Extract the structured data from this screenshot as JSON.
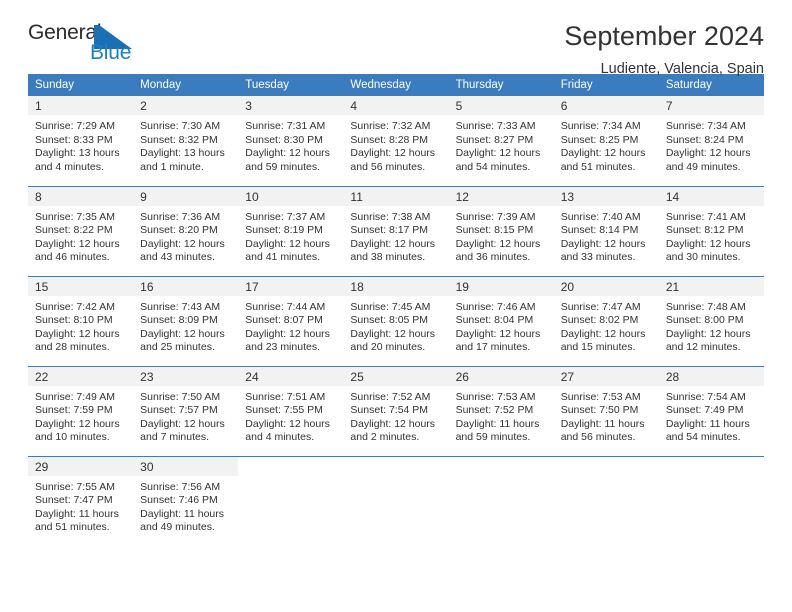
{
  "brand": {
    "name_top": "General",
    "name_bottom": "Blue",
    "accent_color": "#1b6fb5",
    "text_color": "#2b2b2b"
  },
  "header": {
    "month_title": "September 2024",
    "location": "Ludiente, Valencia, Spain"
  },
  "calendar": {
    "header_bg": "#3a7cbe",
    "daynum_bg": "#f2f2f2",
    "weekday_headers": [
      "Sunday",
      "Monday",
      "Tuesday",
      "Wednesday",
      "Thursday",
      "Friday",
      "Saturday"
    ],
    "weeks": [
      [
        {
          "day": "1",
          "sunrise": "Sunrise: 7:29 AM",
          "sunset": "Sunset: 8:33 PM",
          "daylight_line1": "Daylight: 13 hours",
          "daylight_line2": "and 4 minutes."
        },
        {
          "day": "2",
          "sunrise": "Sunrise: 7:30 AM",
          "sunset": "Sunset: 8:32 PM",
          "daylight_line1": "Daylight: 13 hours",
          "daylight_line2": "and 1 minute."
        },
        {
          "day": "3",
          "sunrise": "Sunrise: 7:31 AM",
          "sunset": "Sunset: 8:30 PM",
          "daylight_line1": "Daylight: 12 hours",
          "daylight_line2": "and 59 minutes."
        },
        {
          "day": "4",
          "sunrise": "Sunrise: 7:32 AM",
          "sunset": "Sunset: 8:28 PM",
          "daylight_line1": "Daylight: 12 hours",
          "daylight_line2": "and 56 minutes."
        },
        {
          "day": "5",
          "sunrise": "Sunrise: 7:33 AM",
          "sunset": "Sunset: 8:27 PM",
          "daylight_line1": "Daylight: 12 hours",
          "daylight_line2": "and 54 minutes."
        },
        {
          "day": "6",
          "sunrise": "Sunrise: 7:34 AM",
          "sunset": "Sunset: 8:25 PM",
          "daylight_line1": "Daylight: 12 hours",
          "daylight_line2": "and 51 minutes."
        },
        {
          "day": "7",
          "sunrise": "Sunrise: 7:34 AM",
          "sunset": "Sunset: 8:24 PM",
          "daylight_line1": "Daylight: 12 hours",
          "daylight_line2": "and 49 minutes."
        }
      ],
      [
        {
          "day": "8",
          "sunrise": "Sunrise: 7:35 AM",
          "sunset": "Sunset: 8:22 PM",
          "daylight_line1": "Daylight: 12 hours",
          "daylight_line2": "and 46 minutes."
        },
        {
          "day": "9",
          "sunrise": "Sunrise: 7:36 AM",
          "sunset": "Sunset: 8:20 PM",
          "daylight_line1": "Daylight: 12 hours",
          "daylight_line2": "and 43 minutes."
        },
        {
          "day": "10",
          "sunrise": "Sunrise: 7:37 AM",
          "sunset": "Sunset: 8:19 PM",
          "daylight_line1": "Daylight: 12 hours",
          "daylight_line2": "and 41 minutes."
        },
        {
          "day": "11",
          "sunrise": "Sunrise: 7:38 AM",
          "sunset": "Sunset: 8:17 PM",
          "daylight_line1": "Daylight: 12 hours",
          "daylight_line2": "and 38 minutes."
        },
        {
          "day": "12",
          "sunrise": "Sunrise: 7:39 AM",
          "sunset": "Sunset: 8:15 PM",
          "daylight_line1": "Daylight: 12 hours",
          "daylight_line2": "and 36 minutes."
        },
        {
          "day": "13",
          "sunrise": "Sunrise: 7:40 AM",
          "sunset": "Sunset: 8:14 PM",
          "daylight_line1": "Daylight: 12 hours",
          "daylight_line2": "and 33 minutes."
        },
        {
          "day": "14",
          "sunrise": "Sunrise: 7:41 AM",
          "sunset": "Sunset: 8:12 PM",
          "daylight_line1": "Daylight: 12 hours",
          "daylight_line2": "and 30 minutes."
        }
      ],
      [
        {
          "day": "15",
          "sunrise": "Sunrise: 7:42 AM",
          "sunset": "Sunset: 8:10 PM",
          "daylight_line1": "Daylight: 12 hours",
          "daylight_line2": "and 28 minutes."
        },
        {
          "day": "16",
          "sunrise": "Sunrise: 7:43 AM",
          "sunset": "Sunset: 8:09 PM",
          "daylight_line1": "Daylight: 12 hours",
          "daylight_line2": "and 25 minutes."
        },
        {
          "day": "17",
          "sunrise": "Sunrise: 7:44 AM",
          "sunset": "Sunset: 8:07 PM",
          "daylight_line1": "Daylight: 12 hours",
          "daylight_line2": "and 23 minutes."
        },
        {
          "day": "18",
          "sunrise": "Sunrise: 7:45 AM",
          "sunset": "Sunset: 8:05 PM",
          "daylight_line1": "Daylight: 12 hours",
          "daylight_line2": "and 20 minutes."
        },
        {
          "day": "19",
          "sunrise": "Sunrise: 7:46 AM",
          "sunset": "Sunset: 8:04 PM",
          "daylight_line1": "Daylight: 12 hours",
          "daylight_line2": "and 17 minutes."
        },
        {
          "day": "20",
          "sunrise": "Sunrise: 7:47 AM",
          "sunset": "Sunset: 8:02 PM",
          "daylight_line1": "Daylight: 12 hours",
          "daylight_line2": "and 15 minutes."
        },
        {
          "day": "21",
          "sunrise": "Sunrise: 7:48 AM",
          "sunset": "Sunset: 8:00 PM",
          "daylight_line1": "Daylight: 12 hours",
          "daylight_line2": "and 12 minutes."
        }
      ],
      [
        {
          "day": "22",
          "sunrise": "Sunrise: 7:49 AM",
          "sunset": "Sunset: 7:59 PM",
          "daylight_line1": "Daylight: 12 hours",
          "daylight_line2": "and 10 minutes."
        },
        {
          "day": "23",
          "sunrise": "Sunrise: 7:50 AM",
          "sunset": "Sunset: 7:57 PM",
          "daylight_line1": "Daylight: 12 hours",
          "daylight_line2": "and 7 minutes."
        },
        {
          "day": "24",
          "sunrise": "Sunrise: 7:51 AM",
          "sunset": "Sunset: 7:55 PM",
          "daylight_line1": "Daylight: 12 hours",
          "daylight_line2": "and 4 minutes."
        },
        {
          "day": "25",
          "sunrise": "Sunrise: 7:52 AM",
          "sunset": "Sunset: 7:54 PM",
          "daylight_line1": "Daylight: 12 hours",
          "daylight_line2": "and 2 minutes."
        },
        {
          "day": "26",
          "sunrise": "Sunrise: 7:53 AM",
          "sunset": "Sunset: 7:52 PM",
          "daylight_line1": "Daylight: 11 hours",
          "daylight_line2": "and 59 minutes."
        },
        {
          "day": "27",
          "sunrise": "Sunrise: 7:53 AM",
          "sunset": "Sunset: 7:50 PM",
          "daylight_line1": "Daylight: 11 hours",
          "daylight_line2": "and 56 minutes."
        },
        {
          "day": "28",
          "sunrise": "Sunrise: 7:54 AM",
          "sunset": "Sunset: 7:49 PM",
          "daylight_line1": "Daylight: 11 hours",
          "daylight_line2": "and 54 minutes."
        }
      ],
      [
        {
          "day": "29",
          "sunrise": "Sunrise: 7:55 AM",
          "sunset": "Sunset: 7:47 PM",
          "daylight_line1": "Daylight: 11 hours",
          "daylight_line2": "and 51 minutes."
        },
        {
          "day": "30",
          "sunrise": "Sunrise: 7:56 AM",
          "sunset": "Sunset: 7:46 PM",
          "daylight_line1": "Daylight: 11 hours",
          "daylight_line2": "and 49 minutes."
        },
        {
          "day": "",
          "sunrise": "",
          "sunset": "",
          "daylight_line1": "",
          "daylight_line2": ""
        },
        {
          "day": "",
          "sunrise": "",
          "sunset": "",
          "daylight_line1": "",
          "daylight_line2": ""
        },
        {
          "day": "",
          "sunrise": "",
          "sunset": "",
          "daylight_line1": "",
          "daylight_line2": ""
        },
        {
          "day": "",
          "sunrise": "",
          "sunset": "",
          "daylight_line1": "",
          "daylight_line2": ""
        },
        {
          "day": "",
          "sunrise": "",
          "sunset": "",
          "daylight_line1": "",
          "daylight_line2": ""
        }
      ]
    ]
  }
}
